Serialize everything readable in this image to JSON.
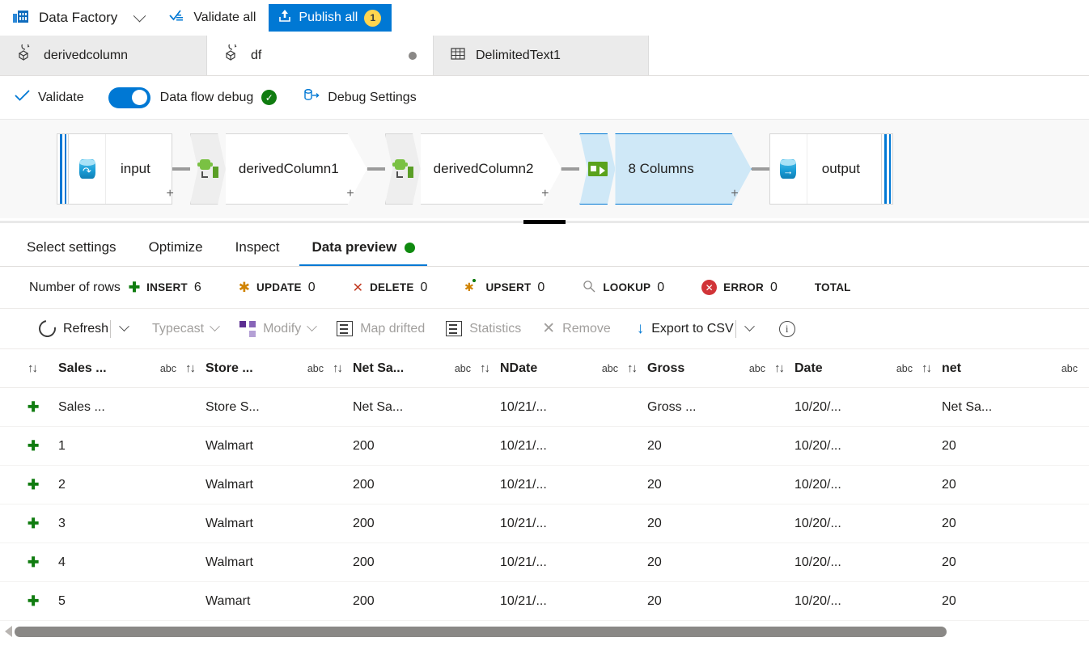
{
  "topbar": {
    "brand": "Data Factory",
    "brand_icon": "factory-icon",
    "brand_chevron": "chevron-down-icon",
    "validate_all": "Validate all",
    "validate_all_icon": "validate-all-icon",
    "publish_all": "Publish all",
    "publish_count": "1",
    "publish_icon": "upload-icon"
  },
  "tabs": [
    {
      "label": "derivedcolumn",
      "icon": "dataflow-icon",
      "active": false,
      "dirty": false
    },
    {
      "label": "df",
      "icon": "dataflow-icon",
      "active": true,
      "dirty": true
    },
    {
      "label": "DelimitedText1",
      "icon": "table-icon",
      "active": false,
      "dirty": false
    }
  ],
  "debugbar": {
    "validate": "Validate",
    "validate_icon": "checkmark-icon",
    "data_flow_debug": "Data flow debug",
    "debug_toggle_on": true,
    "debug_status_icon": "success-check-icon",
    "debug_settings": "Debug Settings",
    "debug_settings_icon": "debug-settings-icon"
  },
  "canvas": {
    "source": {
      "label": "input",
      "icon": "source-database-icon"
    },
    "transforms": [
      {
        "label": "derivedColumn1",
        "icon": "derived-column-icon",
        "selected": false
      },
      {
        "label": "derivedColumn2",
        "icon": "derived-column-icon",
        "selected": false
      },
      {
        "label": "8 Columns",
        "icon": "select-transform-icon",
        "selected": true
      }
    ],
    "sink": {
      "label": "output",
      "icon": "sink-database-icon"
    },
    "add_symbol": "+"
  },
  "panel_tabs": [
    {
      "label": "Select settings",
      "active": false,
      "dot": false
    },
    {
      "label": "Optimize",
      "active": false,
      "dot": false
    },
    {
      "label": "Inspect",
      "active": false,
      "dot": false
    },
    {
      "label": "Data preview",
      "active": true,
      "dot": true
    }
  ],
  "row_stats": {
    "title": "Number of rows",
    "items": [
      {
        "key": "INSERT",
        "value": "6",
        "icon": "plus-icon"
      },
      {
        "key": "UPDATE",
        "value": "0",
        "icon": "asterisk-icon"
      },
      {
        "key": "DELETE",
        "value": "0",
        "icon": "cross-icon"
      },
      {
        "key": "UPSERT",
        "value": "0",
        "icon": "asterisk-plus-icon"
      },
      {
        "key": "LOOKUP",
        "value": "0",
        "icon": "magnifier-icon"
      },
      {
        "key": "ERROR",
        "value": "0",
        "icon": "error-circle-icon"
      },
      {
        "key": "TOTAL",
        "value": "",
        "icon": "none"
      }
    ]
  },
  "preview_toolbar": {
    "refresh": "Refresh",
    "refresh_icon": "refresh-icon",
    "refresh_caret": "chevron-down-icon",
    "typecast": "Typecast",
    "typecast_caret": "chevron-down-icon",
    "modify": "Modify",
    "modify_icon": "modify-icon",
    "modify_caret": "chevron-down-icon",
    "map_drifted": "Map drifted",
    "map_drifted_icon": "map-drifted-icon",
    "statistics": "Statistics",
    "statistics_icon": "statistics-icon",
    "remove": "Remove",
    "remove_icon": "close-icon",
    "export_csv": "Export to CSV",
    "export_icon": "download-icon",
    "export_caret": "chevron-down-icon",
    "info_icon": "info-icon"
  },
  "grid": {
    "sort_all_icon": "sort-icon",
    "row_add_icon": "plus-icon",
    "type_label": "abc",
    "sort_icon": "sort-icon",
    "columns": [
      {
        "name": "Sales ...",
        "type": "abc"
      },
      {
        "name": "Store ...",
        "type": "abc"
      },
      {
        "name": "Net Sa...",
        "type": "abc"
      },
      {
        "name": "NDate",
        "type": "abc"
      },
      {
        "name": "Gross",
        "type": "abc"
      },
      {
        "name": "Date",
        "type": "abc"
      },
      {
        "name": "net",
        "type": "abc"
      }
    ],
    "rows": [
      [
        "Sales ...",
        "Store S...",
        "Net Sa...",
        "10/21/...",
        "Gross ...",
        "10/20/...",
        "Net Sa..."
      ],
      [
        "1",
        "Walmart",
        "200",
        "10/21/...",
        "20",
        "10/20/...",
        "20"
      ],
      [
        "2",
        "Walmart",
        "200",
        "10/21/...",
        "20",
        "10/20/...",
        "20"
      ],
      [
        "3",
        "Walmart",
        "200",
        "10/21/...",
        "20",
        "10/20/...",
        "20"
      ],
      [
        "4",
        "Walmart",
        "200",
        "10/21/...",
        "20",
        "10/20/...",
        "20"
      ],
      [
        "5",
        "Wamart",
        "200",
        "10/21/...",
        "20",
        "10/20/...",
        "20"
      ]
    ]
  },
  "colors": {
    "accent": "#0078d4",
    "success": "#107c10",
    "error": "#d13438",
    "badge": "#ffd54f"
  }
}
